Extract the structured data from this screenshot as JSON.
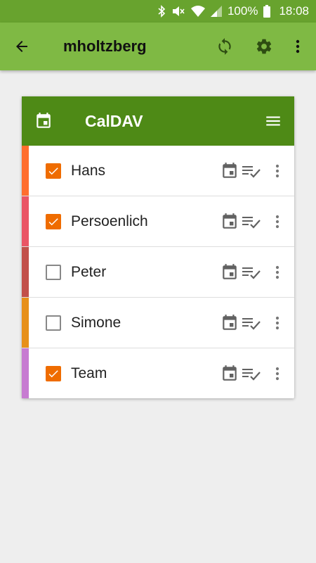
{
  "status_bar": {
    "battery": "100%",
    "time": "18:08",
    "icons": [
      "bluetooth-icon",
      "mute-icon",
      "wifi-icon",
      "signal-icon",
      "battery-icon"
    ]
  },
  "app_bar": {
    "title": "mholtzberg",
    "icons": [
      "back-arrow-icon",
      "sync-icon",
      "gear-icon",
      "more-vertical-icon"
    ]
  },
  "card": {
    "title": "CalDAV",
    "icons": [
      "calendar-icon",
      "menu-icon"
    ],
    "calendars": [
      {
        "name": "Hans",
        "checked": true,
        "color": "#ff6e2e"
      },
      {
        "name": "Persoenlich",
        "checked": true,
        "color": "#ea5565"
      },
      {
        "name": "Peter",
        "checked": false,
        "color": "#c2504a"
      },
      {
        "name": "Simone",
        "checked": false,
        "color": "#e7901a"
      },
      {
        "name": "Team",
        "checked": true,
        "color": "#c77bd1"
      }
    ],
    "row_icons": [
      "calendar-icon",
      "tasks-icon",
      "more-vertical-icon"
    ]
  },
  "colors": {
    "status_bar": "#68a32e",
    "app_bar": "#7fb944",
    "card_header": "#4e8a16",
    "checkbox_on": "#ef6c00",
    "background": "#eeeeee"
  }
}
